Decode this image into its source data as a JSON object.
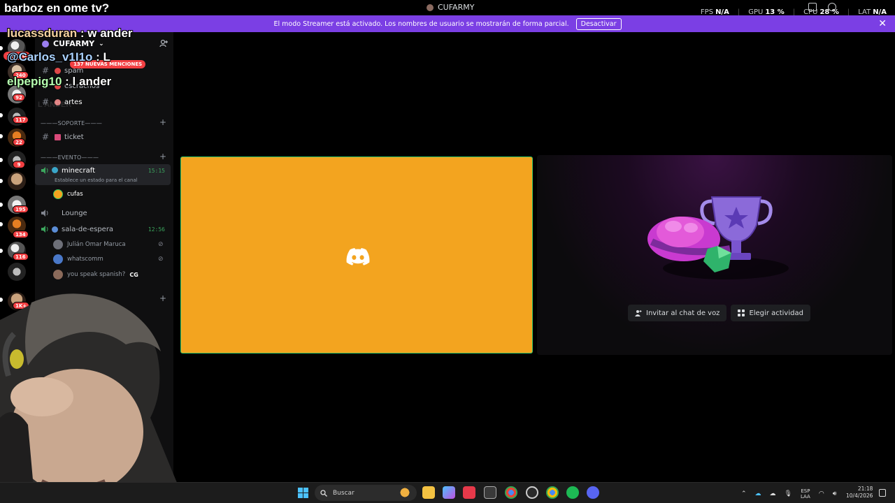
{
  "titlebar": {
    "server_name": "CUFARMY",
    "perf": [
      {
        "label": "FPS",
        "value": "N/A"
      },
      {
        "label": "GPU",
        "value": "13 %"
      },
      {
        "label": "CPU",
        "value": "28 %"
      },
      {
        "label": "LAT",
        "value": "N/A"
      }
    ]
  },
  "banner": {
    "text": "El modo Streamer está activado. Los nombres de usuario se mostrarán de forma parcial.",
    "button": "Desactivar",
    "close": "✕"
  },
  "rail": {
    "nuevo": "NUEVO",
    "badges": [
      "240",
      "92",
      "117",
      "22",
      "9",
      "195",
      "134",
      "116",
      "1K+"
    ]
  },
  "sidebar": {
    "server_name": "CUFARMY",
    "mentions": "137 NUEVAS MENCIONES",
    "channels_top": [
      {
        "name": "spam",
        "emoji_color": "#e04848"
      },
      {
        "name": "escrachos",
        "emoji_color": "#e04848"
      },
      {
        "name": "artes",
        "emoji_color": "#e08080"
      }
    ],
    "category_soporte": "———SOPORTE———",
    "ticket": "ticket",
    "category_evento": "———EVENTO———",
    "voice_minecraft": {
      "name": "minecraft",
      "time": "15:15",
      "status": "Establece un estado para el canal"
    },
    "user_cufas": "cufas",
    "voice_lounge": "Lounge",
    "voice_sala": {
      "name": "sala-de-espera",
      "time": "12:56"
    },
    "sala_users": [
      {
        "name": "Julián Omar Maruca"
      },
      {
        "name": "whatscomm"
      },
      {
        "name": "you speak spanish?",
        "tag": "CG"
      }
    ],
    "ghost_text": "L ANDER"
  },
  "stage": {
    "invite_label": "Invitar al chat de voz",
    "activity_label": "Elegir actividad"
  },
  "overlay": {
    "title": "barboz en ome tv?",
    "chat": [
      {
        "user": "lucassduran",
        "msg": ": w ander"
      },
      {
        "user": "@Carlos_v1I1o",
        "msg": ": L"
      },
      {
        "user": "elpepig10",
        "msg": ": l ander"
      }
    ]
  },
  "taskbar": {
    "search_placeholder": "Buscar",
    "lang_top": "ESP",
    "lang_bottom": "LAA",
    "time": "21:18",
    "date": "10/4/2026"
  },
  "colors": {
    "banner": "#7b3fe4",
    "stage_tile": "#f3a41f",
    "speaking_border": "#33c463",
    "mention_badge": "#f23f42"
  }
}
